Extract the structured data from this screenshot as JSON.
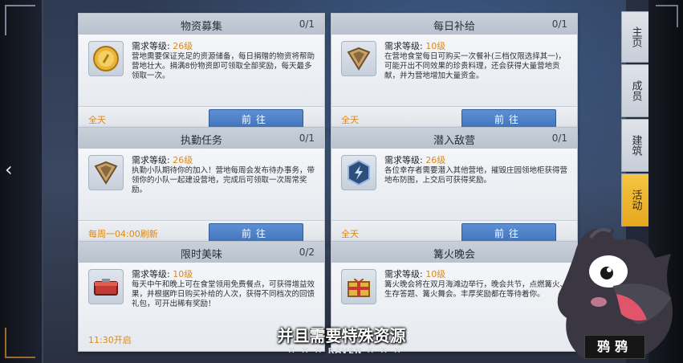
{
  "nav": {
    "back_icon": "chevron-left-icon"
  },
  "cards": [
    {
      "title": "物资募集",
      "count": "0/1",
      "req_label": "需求等级:",
      "level": "26级",
      "desc": "营地需要保证充足的资源储备，每日捐赠的物资将帮助营地壮大。捐满8份物资即可领取全部奖励，每天最多领取一次。",
      "time": "全天",
      "button": "前往",
      "icon": "coin-icon"
    },
    {
      "title": "每日补给",
      "count": "0/1",
      "req_label": "需求等级:",
      "level": "10级",
      "desc": "在营地食堂每日可购买一次餐补(三档仅限选择其一)，可能开出不同效果的珍贵料理，还会获得大量营地贡献，并为营地增加大量资金。",
      "time": "全天",
      "button": "前往",
      "icon": "badge-icon"
    },
    {
      "title": "执勤任务",
      "count": "0/1",
      "req_label": "需求等级:",
      "level": "26级",
      "desc": "执勤小队期待你的加入！营地每周会发布待办事务，带领你的小队一起建设营地，完成后可领取一次周常奖励。",
      "time": "每周一04:00刷新",
      "button": "前往",
      "icon": "badge-icon"
    },
    {
      "title": "潜入敌营",
      "count": "0/1",
      "req_label": "需求等级:",
      "level": "26级",
      "desc": "各位幸存者需要潜入其他营地，摧毁庄园领地柜获得营地布防图，上交后可获得奖励。",
      "time": "全天",
      "button": "前往",
      "icon": "lightning-icon"
    },
    {
      "title": "限时美味",
      "count": "0/2",
      "req_label": "需求等级:",
      "level": "10级",
      "desc": "每天中午和晚上可在食堂领用免费餐点，可获得增益效果，并根据昨日购买补给的人次，获得不同档次的回馈礼包，可开出稀有奖励！",
      "time": "11:30开启",
      "button": "",
      "icon": "lunchbox-icon"
    },
    {
      "title": "篝火晚会",
      "count": "",
      "req_label": "需求等级:",
      "level": "10级",
      "desc": "篝火晚会将在双月海滩边举行，晚会共节，点燃篝火、生存答题、篝火舞会。丰厚奖励都在等待着你。",
      "time": "",
      "button": "",
      "icon": "gift-icon"
    }
  ],
  "tabs": [
    "主页",
    "成员",
    "建筑",
    "活动"
  ],
  "active_tab": "活动",
  "subtitle": "并且需要特殊资源",
  "watermark": {
    "left": "✕ ✕ ✕",
    "brand": "RAVEN",
    "right": "✕ ✕ ✕"
  },
  "mascot_name": "鸦鸦",
  "colors": {
    "accent": "#d98a1c",
    "button": "#4a7fc6",
    "active_tab": "#f0b830"
  }
}
